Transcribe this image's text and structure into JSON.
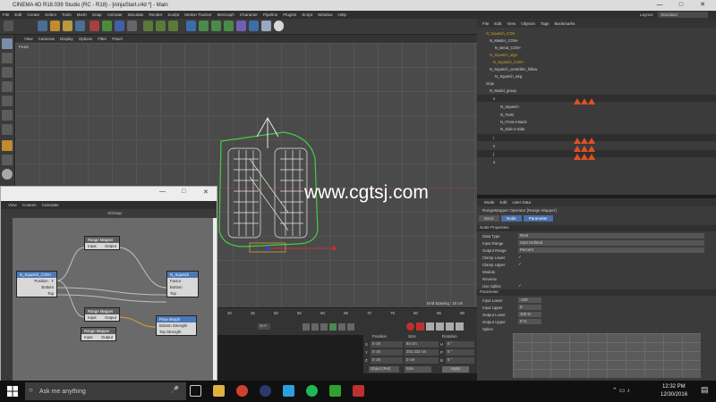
{
  "window": {
    "title": "CINEMA 4D R18.039 Studio (RC - R18) - [ninjaStart.c4d *] - Main",
    "minimize": "—",
    "maximize": "□",
    "close": "✕"
  },
  "menu": [
    "File",
    "Edit",
    "Create",
    "Select",
    "Tools",
    "Mesh",
    "Snap",
    "Animate",
    "Simulate",
    "Render",
    "Sculpt",
    "Motion Tracker",
    "MoGraph",
    "Character",
    "Pipeline",
    "Plugins",
    "Script",
    "Window",
    "Help"
  ],
  "layout": {
    "label": "Layout:",
    "value": "Standard"
  },
  "viewport": {
    "menu": [
      "View",
      "Cameras",
      "Display",
      "Options",
      "Filter",
      "Panel"
    ],
    "label": "Front",
    "grid_spacing": "Grid Spacing : 10 cm"
  },
  "objects_menu": [
    "File",
    "Edit",
    "View",
    "Objects",
    "Tags",
    "Bookmarks"
  ],
  "objects": [
    "N_Squetch_CON",
    "N_Master_CON+",
    "N_Bend_CON+",
    "N_Squetch_algo",
    "N_Squetch_CON+",
    "N_Squetch_controller_follow",
    "N_Squetch_targ",
    "ninja",
    "N_Model_group",
    "n",
    "N_Squetch",
    "N_Twist",
    "N_Front-2-Back",
    "N_Side-2-Side",
    "i",
    "n",
    "j",
    "a"
  ],
  "attributes": {
    "menu": [
      "Mode",
      "Edit",
      "User Data"
    ],
    "title": "RangeMapper Operator [Range Mapper]",
    "tabs": [
      "Basic",
      "Node",
      "Parameter"
    ],
    "node_properties": "Node Properties",
    "rows": [
      {
        "label": "Data Type",
        "value": "Real"
      },
      {
        "label": "Input Range",
        "value": "User Defined"
      },
      {
        "label": "Output Range",
        "value": "Percent"
      },
      {
        "label": "Clamp Lower",
        "value": "✓"
      },
      {
        "label": "Clamp Upper",
        "value": "✓"
      },
      {
        "label": "Modulo",
        "value": ""
      },
      {
        "label": "Reverse",
        "value": ""
      },
      {
        "label": "Use Spline",
        "value": "✓"
      }
    ],
    "parameter_header": "Parameter",
    "params": [
      {
        "label": "Input Lower",
        "value": "-100"
      },
      {
        "label": "Input Upper",
        "value": "0"
      },
      {
        "label": "Output Lower",
        "value": "100 %"
      },
      {
        "label": "Output Upper",
        "value": "0 %"
      },
      {
        "label": "Spline",
        "value": ""
      }
    ]
  },
  "xpresso": {
    "menu": [
      "View",
      "Custom",
      "Calculate"
    ],
    "group_title": "XGroup",
    "nodes": [
      {
        "title": "N_Squetch_CON+",
        "ports": [
          "Position . Y",
          "Bottom",
          "Top"
        ]
      },
      {
        "title": "Range Mapper",
        "ports": [
          "Input",
          "Output"
        ]
      },
      {
        "title": "N_Squetch",
        "ports": [
          "Factor",
          "Bottom",
          "Top"
        ]
      },
      {
        "title": "Range Mapper",
        "ports": [
          "Input",
          "Output"
        ]
      },
      {
        "title": "Pose Morph",
        "ports": [
          "Bottom Strength",
          "Top Strength"
        ]
      },
      {
        "title": "Range Mapper",
        "ports": [
          "Input",
          "Output"
        ]
      }
    ]
  },
  "timeline": {
    "ticks": [
      "40",
      "45",
      "50",
      "55",
      "60",
      "65",
      "70",
      "75",
      "80",
      "85",
      "90"
    ],
    "frame": "90 F",
    "start": "1 F"
  },
  "coordinates": {
    "headers": [
      "Position",
      "Size",
      "Rotation"
    ],
    "rows": [
      {
        "axis": "X",
        "pos": "0 cm",
        "size": "54 cm",
        "rotaxis": "H",
        "rot": "0 °"
      },
      {
        "axis": "Y",
        "pos": "0 cm",
        "size": "202.332 cm",
        "rotaxis": "P",
        "rot": "0 °"
      },
      {
        "axis": "Z",
        "pos": "0 cm",
        "size": "0 cm",
        "rotaxis": "B",
        "rot": "0 °"
      }
    ],
    "mode": "Object (Rel)",
    "size_mode": "Size",
    "apply": "Apply"
  },
  "watermark": "www.cgtsj.com",
  "taskbar": {
    "search": "Ask me anything",
    "time": "12:32 PM",
    "date": "12/30/2016"
  }
}
